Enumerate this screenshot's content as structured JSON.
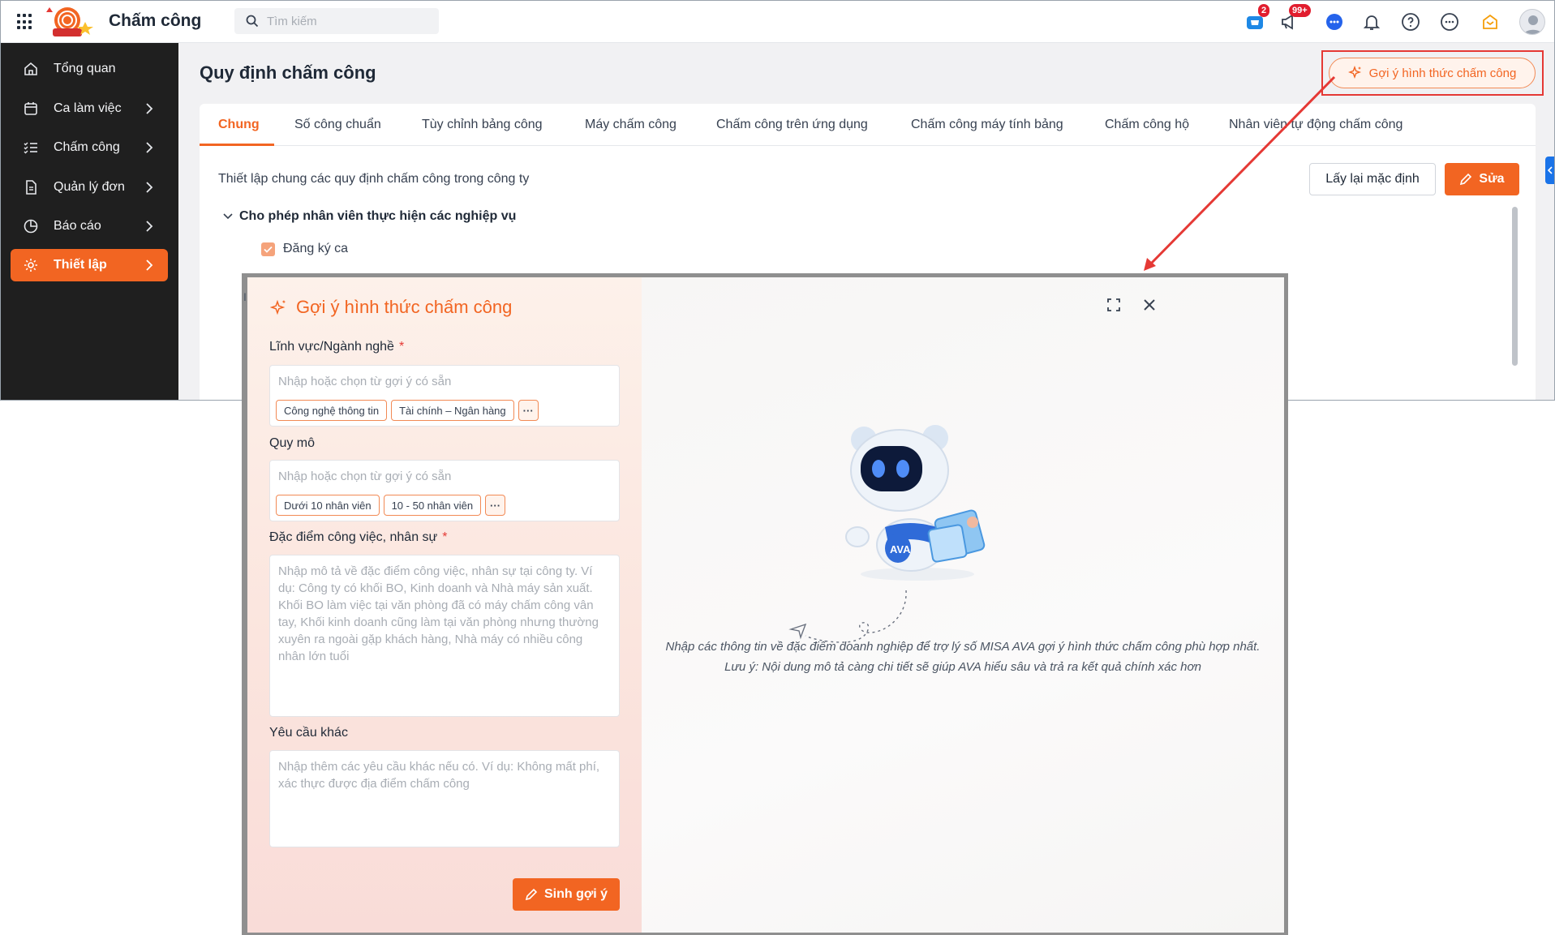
{
  "app": {
    "title": "Chấm công",
    "search_placeholder": "Tìm kiếm",
    "cart_badge": "2",
    "notify_badge": "99+"
  },
  "sidebar": {
    "items": [
      {
        "label": "Tổng quan",
        "icon": "home-icon"
      },
      {
        "label": "Ca làm việc",
        "icon": "calendar-icon"
      },
      {
        "label": "Chấm công",
        "icon": "list-check-icon"
      },
      {
        "label": "Quản lý đơn",
        "icon": "document-icon"
      },
      {
        "label": "Báo cáo",
        "icon": "pie-chart-icon"
      },
      {
        "label": "Thiết lập",
        "icon": "gear-icon"
      }
    ]
  },
  "page": {
    "title": "Quy định chấm công",
    "suggest_button": "Gợi ý hình thức chấm công",
    "tabs": [
      "Chung",
      "Số công chuẩn",
      "Tùy chỉnh bảng công",
      "Máy chấm công",
      "Chấm công trên ứng dụng",
      "Chấm công máy tính bảng",
      "Chấm công hộ",
      "Nhân viên tự động chấm công"
    ],
    "description": "Thiết lập chung các quy định chấm công trong công ty",
    "reset_button": "Lấy lại mặc định",
    "edit_button": "Sửa",
    "section_title": "Cho phép nhân viên thực hiện các nghiệp vụ",
    "checkbox_label": "Đăng ký ca"
  },
  "dialog": {
    "title": "Gợi ý hình thức chấm công",
    "field_industry_label": "Lĩnh vực/Ngành nghề",
    "field_industry_placeholder": "Nhập hoặc chọn từ gợi ý có sẵn",
    "industry_chips": [
      "Công nghệ thông tin",
      "Tài chính – Ngân hàng"
    ],
    "field_scale_label": "Quy mô",
    "field_scale_placeholder": "Nhập hoặc chọn từ gợi ý có sẵn",
    "scale_chips": [
      "Dưới 10 nhân viên",
      "10 - 50 nhân viên"
    ],
    "field_work_label": "Đặc điểm công việc, nhân sự",
    "field_work_placeholder": "Nhập mô tả về đặc điểm công việc, nhân sự tại công ty. Ví dụ: Công ty có khối BO, Kinh doanh và Nhà máy sản xuất. Khối BO làm việc tại văn phòng đã có máy chấm công vân tay, Khối kinh doanh cũng làm tại văn phòng nhưng thường xuyên ra ngoài gặp khách hàng, Nhà máy có nhiều công nhân lớn tuổi",
    "field_other_label": "Yêu cầu khác",
    "field_other_placeholder": "Nhập thêm các yêu cầu khác nếu có. Ví dụ: Không mất phí, xác thực được địa điểm chấm công",
    "required_mark": "*",
    "more_chip": "···",
    "generate_button": "Sinh gợi ý",
    "hint": "Nhập các thông tin về đặc điểm doanh nghiệp để trợ lý số MISA AVA gợi ý hình thức chấm công phù hợp nhất. Lưu ý: Nội dung mô tả càng chi tiết sẽ giúp AVA hiểu sâu và trả ra kết quả chính xác hơn",
    "robot_label": "AVA"
  },
  "colors": {
    "accent": "#f26522",
    "sidebar_bg": "#1f1f1f",
    "highlight": "#e53935"
  }
}
